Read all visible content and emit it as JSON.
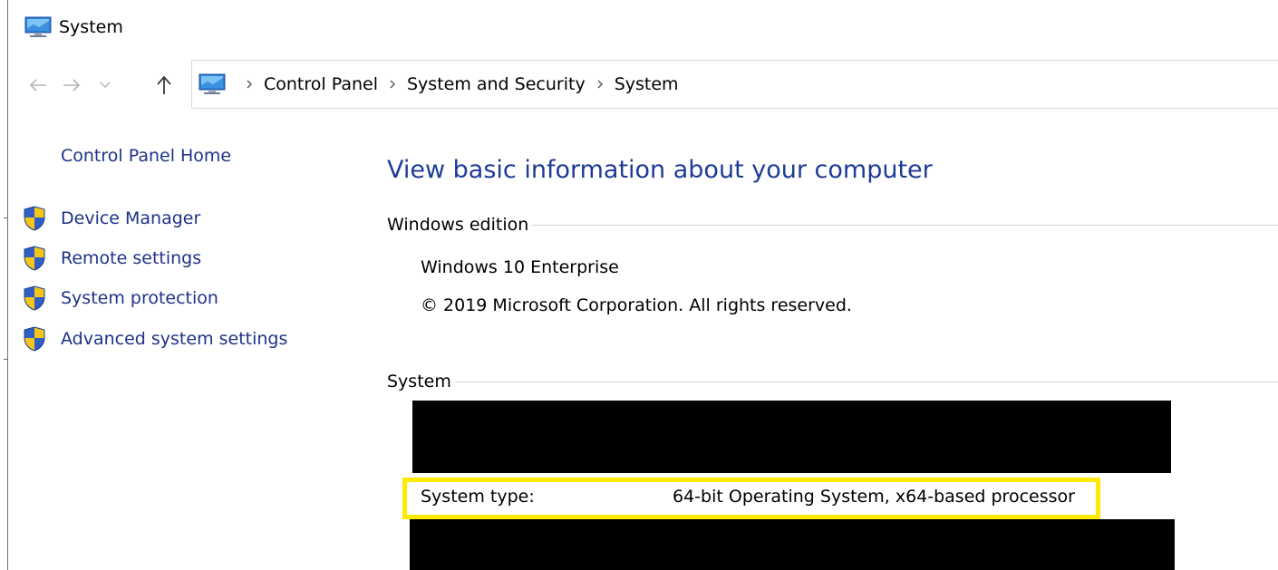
{
  "window": {
    "title": "System",
    "icon": "monitor-system-icon"
  },
  "navigation": {
    "back_icon": "back-arrow-icon",
    "forward_icon": "forward-arrow-icon",
    "recent_icon": "chevron-down-icon",
    "up_icon": "up-arrow-icon",
    "breadcrumb": [
      "Control Panel",
      "System and Security",
      "System"
    ]
  },
  "sidebar": {
    "home_label": "Control Panel Home",
    "tasks": [
      {
        "label": "Device Manager",
        "icon": "uac-shield-icon"
      },
      {
        "label": "Remote settings",
        "icon": "uac-shield-icon"
      },
      {
        "label": "System protection",
        "icon": "uac-shield-icon"
      },
      {
        "label": "Advanced system settings",
        "icon": "uac-shield-icon"
      }
    ]
  },
  "main": {
    "title": "View basic information about your computer",
    "windows_edition": {
      "heading": "Windows edition",
      "edition": "Windows 10 Enterprise",
      "copyright": "© 2019 Microsoft Corporation. All rights reserved."
    },
    "system": {
      "heading": "System",
      "system_type_label": "System type:",
      "system_type_value": "64-bit Operating System, x64-based processor"
    }
  },
  "colors": {
    "link": "#1e3287",
    "title": "#1e3c96",
    "highlight": "#ffea00",
    "redaction": "#000000"
  }
}
